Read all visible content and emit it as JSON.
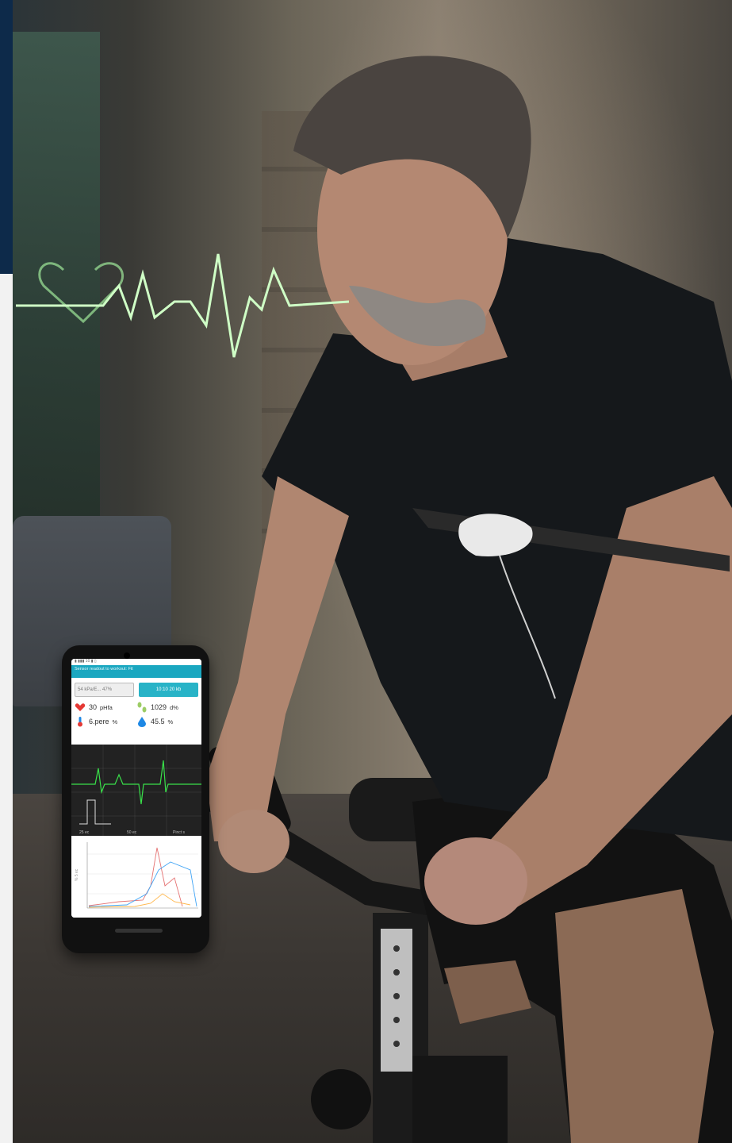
{
  "phone_app": {
    "status_bar": "▮ ▮▮▮ 10 ▮ ▯",
    "app_bar_title": "Sensor readout to workout: Fit",
    "field_value": "54 kPa/E... 47%",
    "action_button": "10:10 20 kb",
    "metrics": [
      {
        "icon": "heart-icon",
        "value": "30",
        "unit": "pHfa",
        "color": "#e53935"
      },
      {
        "icon": "footprints-icon",
        "value": "1029",
        "unit": "d%",
        "color": "#9ccc65"
      },
      {
        "icon": "thermometer-icon",
        "value": "6.pere",
        "unit": "%",
        "color": "#1e88e5"
      },
      {
        "icon": "water-drop-icon",
        "value": "45.5",
        "unit": "%",
        "color": "#1e88e5"
      }
    ],
    "ecg_labels": {
      "x_left": "25 ec",
      "x_mid": "50 ec",
      "x_right": "Pinct s"
    },
    "chart2_ylabel": "% 5 ec"
  },
  "colors": {
    "accent": "#28b3c7",
    "ecg_line": "#39e04a",
    "heartbeat_glow": "#b9ffb0"
  }
}
